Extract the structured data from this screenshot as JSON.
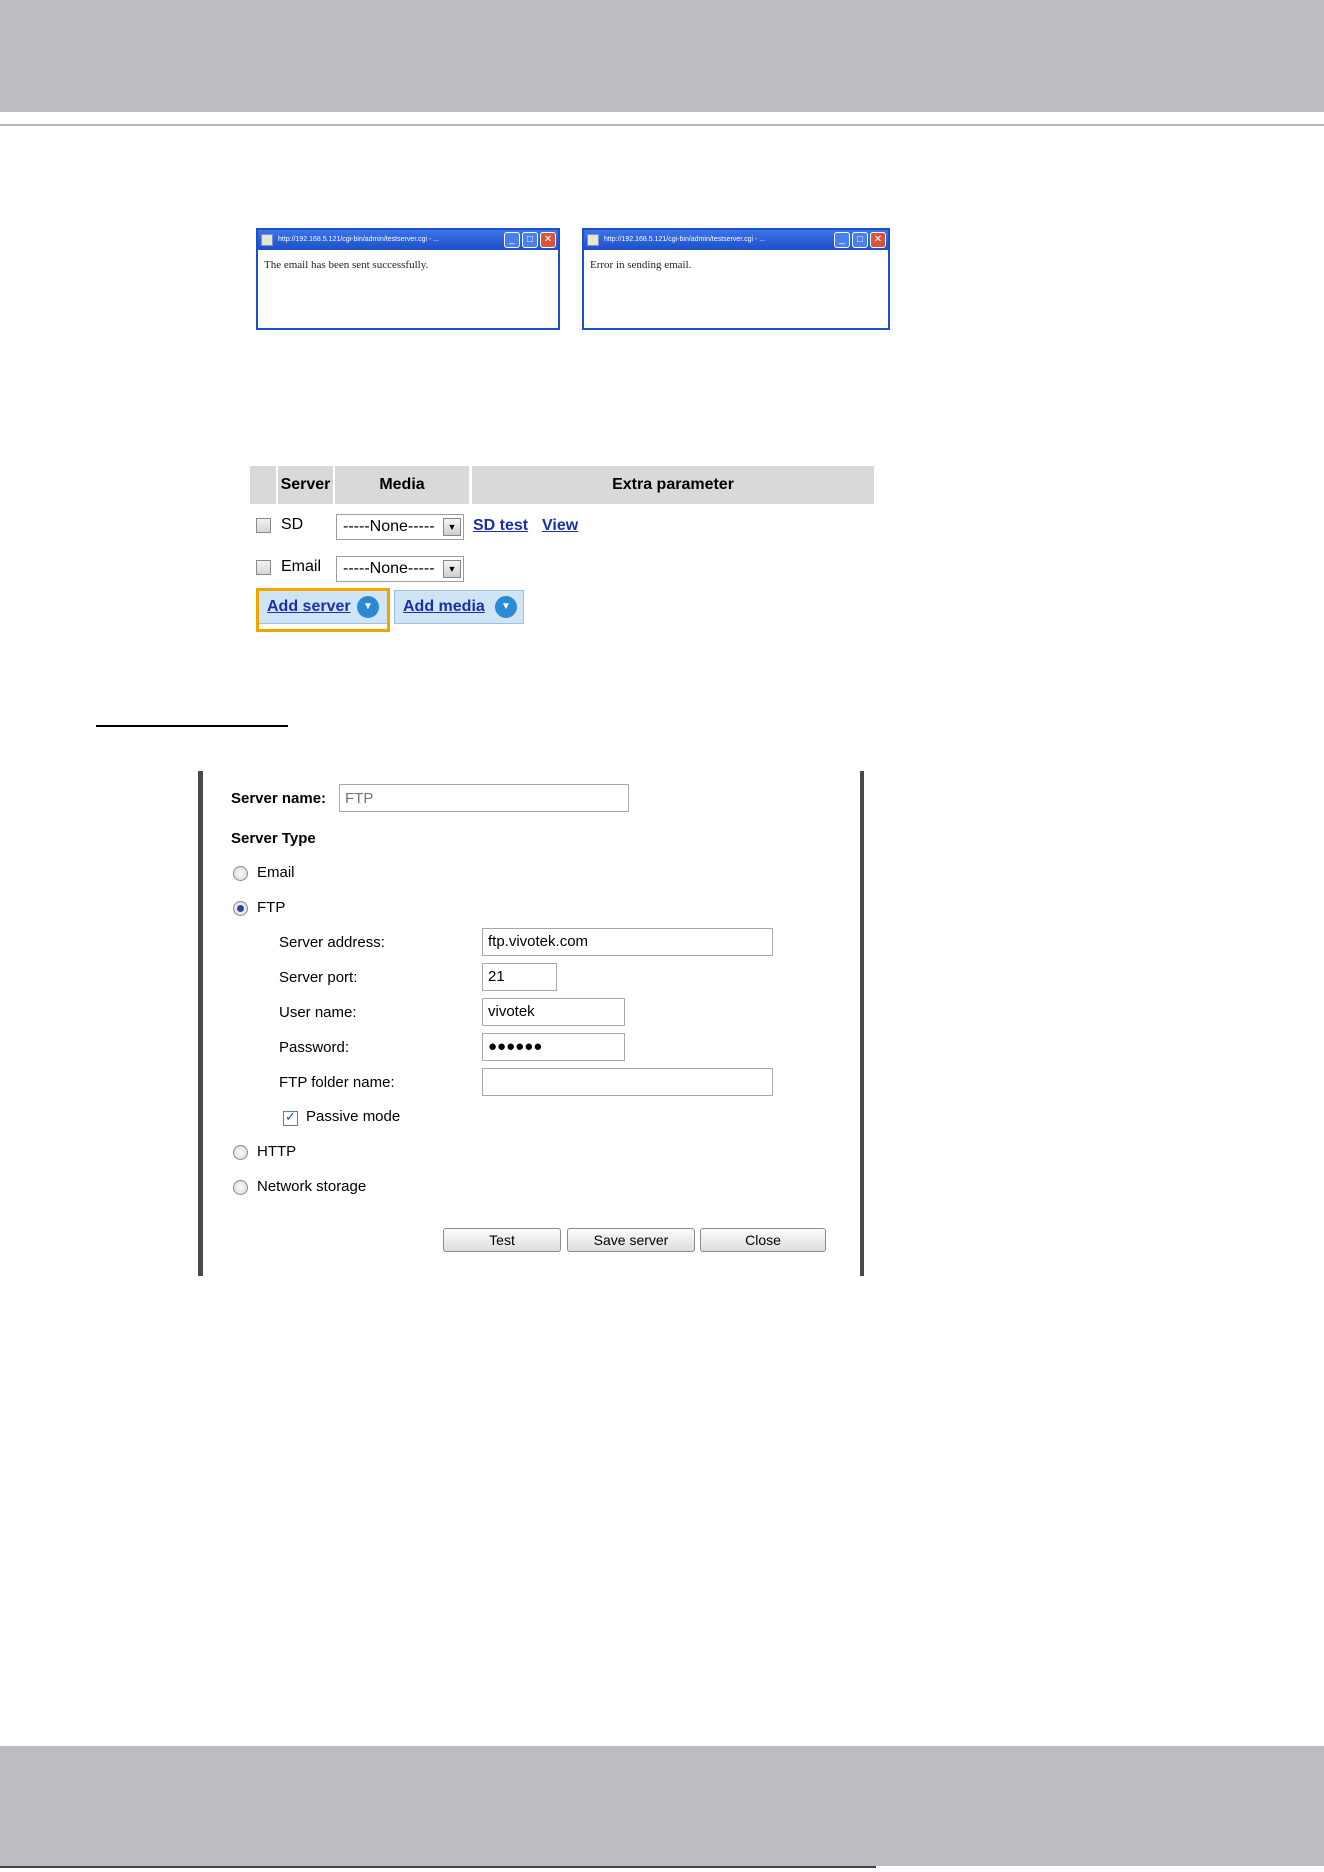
{
  "popups": [
    {
      "title": "http://192.168.5.121/cgi-bin/admin/testserver.cgi - ...",
      "message": "The email has been sent successfully."
    },
    {
      "title": "http://192.168.5.121/cgi-bin/admin/testserver.cgi - ...",
      "message": "Error in sending email."
    }
  ],
  "event_table": {
    "headers": {
      "blank": "",
      "server": "Server",
      "media": "Media",
      "extra": "Extra parameter"
    },
    "rows": [
      {
        "server": "SD",
        "media": "-----None-----",
        "links": [
          "SD test",
          "View"
        ]
      },
      {
        "server": "Email",
        "media": "-----None-----"
      }
    ],
    "add_server": "Add server",
    "add_media": "Add media"
  },
  "dialog": {
    "server_name_label": "Server name:",
    "server_name_placeholder": "FTP",
    "server_type_label": "Server Type",
    "types": [
      "Email",
      "FTP",
      "HTTP",
      "Network storage"
    ],
    "selected_type": "FTP",
    "fields": {
      "server_address": {
        "label": "Server address:",
        "value": "ftp.vivotek.com"
      },
      "server_port": {
        "label": "Server port:",
        "value": "21"
      },
      "user_name": {
        "label": "User name:",
        "value": "vivotek"
      },
      "password": {
        "label": "Password:",
        "value": "●●●●●●"
      },
      "ftp_folder": {
        "label": "FTP folder name:",
        "value": ""
      }
    },
    "passive_mode": {
      "label": "Passive mode",
      "checked": true
    },
    "buttons": {
      "test": "Test",
      "save": "Save server",
      "close": "Close"
    }
  },
  "colors": {
    "band": "#bcbdc0",
    "link": "#1b2fa8",
    "highlight": "#f0a400",
    "button_blue": "#cfe5f5"
  }
}
